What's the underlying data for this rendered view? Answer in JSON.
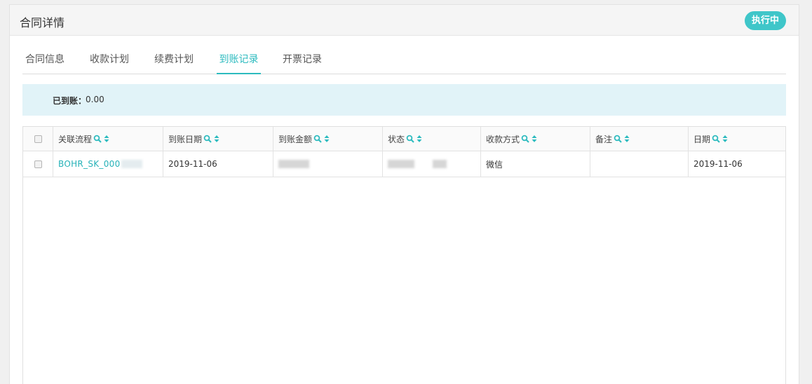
{
  "header": {
    "title": "合同详情",
    "status": "执行中"
  },
  "tabs": [
    {
      "label": "合同信息",
      "active": false
    },
    {
      "label": "收款计划",
      "active": false
    },
    {
      "label": "续费计划",
      "active": false
    },
    {
      "label": "到账记录",
      "active": true
    },
    {
      "label": "开票记录",
      "active": false
    }
  ],
  "summary": {
    "label": "已到账：",
    "value": "0.00"
  },
  "table": {
    "columns": [
      "关联流程",
      "到账日期",
      "到账金额",
      "状态",
      "收款方式",
      "备注",
      "日期"
    ],
    "rows": [
      {
        "process": "BOHR_SK_000",
        "arrival_date": "2019-11-06",
        "amount": "",
        "status": "",
        "method": "微信",
        "remark": "",
        "date": "2019-11-06"
      }
    ]
  },
  "colors": {
    "accent": "#2dbbbf",
    "badge": "#3fc6c9",
    "summary_bg": "#e1f3f8",
    "link": "#26b2b8"
  },
  "icons": {
    "column_search": "search-icon",
    "column_sort": "sort-icon"
  }
}
